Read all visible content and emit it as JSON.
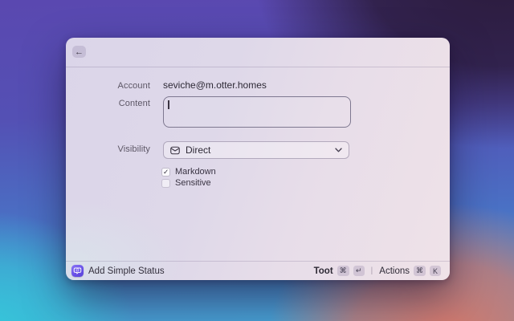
{
  "window": {
    "header": {
      "back_label": "←"
    },
    "form": {
      "account_label": "Account",
      "account_value": "seviche@m.otter.homes",
      "content_label": "Content",
      "content_value": "",
      "visibility_label": "Visibility",
      "visibility_value": "Direct",
      "checkboxes": [
        {
          "label": "Markdown",
          "checked": true,
          "glyph": "✓"
        },
        {
          "label": "Sensitive",
          "checked": false,
          "glyph": ""
        }
      ]
    },
    "footer": {
      "app_label": "Add Simple Status",
      "divider": "|",
      "primary": {
        "label": "Toot",
        "keys": [
          "⌘",
          "↵"
        ]
      },
      "secondary": {
        "label": "Actions",
        "keys": [
          "⌘",
          "K"
        ]
      }
    }
  },
  "colors": {
    "accent_purple": "#6a52e8",
    "wallpaper_violet": "#5a48b0",
    "wallpaper_dark_purple": "#2b1b3c",
    "wallpaper_cyan": "#35c6da",
    "wallpaper_salmon": "#d4786c"
  }
}
